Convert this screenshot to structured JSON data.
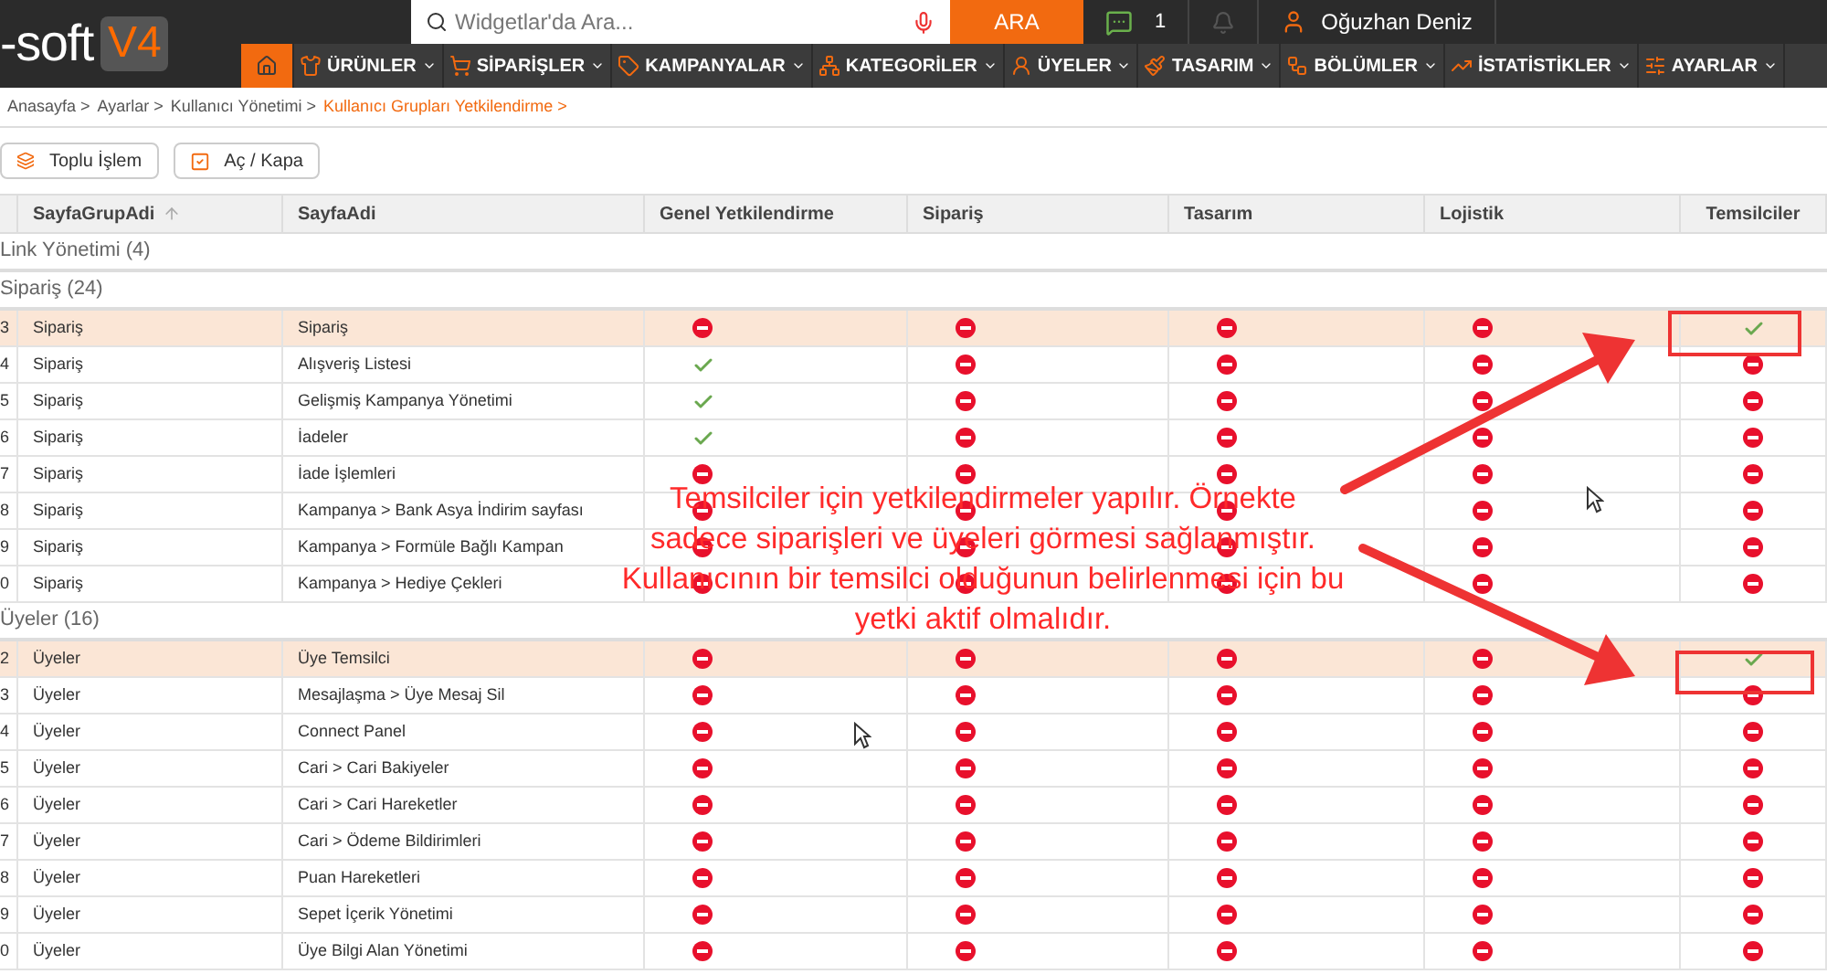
{
  "header": {
    "logo_text": "-soft",
    "logo_version": "V4",
    "search": {
      "placeholder": "Widgetlar'da Ara..."
    },
    "search_button": "ARA",
    "messages_count": "1",
    "user_name": "Oğuzhan Deniz"
  },
  "nav": [
    {
      "selected": true
    },
    {
      "label": "ÜRÜNLER",
      "selected": false
    },
    {
      "label": "SİPARİŞLER",
      "selected": false
    },
    {
      "label": "KAMPANYALAR",
      "selected": false
    },
    {
      "label": "KATEGORİLER",
      "selected": false
    },
    {
      "label": "ÜYELER",
      "selected": false
    },
    {
      "label": "TASARIM",
      "selected": false
    },
    {
      "label": "BÖLÜMLER",
      "selected": false
    },
    {
      "label": "İSTATİSTİKLER",
      "selected": false
    },
    {
      "label": "AYARLAR",
      "selected": false
    }
  ],
  "breadcrumb": [
    {
      "label": "Anasayfa >",
      "current": false
    },
    {
      "label": "Ayarlar >",
      "current": false
    },
    {
      "label": "Kullanıcı Yönetimi >",
      "current": false
    },
    {
      "label": "Kullanıcı Grupları Yetkilendirme >",
      "current": true
    }
  ],
  "toolbar": [
    "Toplu İşlem",
    "Aç / Kapa"
  ],
  "table": {
    "columns": [
      "SayfaGrupAdi",
      "SayfaAdi",
      "Genel Yetkilendirme",
      "Sipariş",
      "Tasarım",
      "Lojistik",
      "Temsilciler"
    ],
    "groups": [
      {
        "title": "Link Yönetimi (4)"
      },
      {
        "title": "Sipariş (24)",
        "rows": [
          {
            "number": "3",
            "group": "Sipariş",
            "page": "Sipariş",
            "selected": true,
            "perms": [
              false,
              false,
              false,
              false,
              true
            ]
          },
          {
            "number": "4",
            "group": "Sipariş",
            "page": "Alışveriş Listesi",
            "selected": false,
            "perms": [
              true,
              false,
              false,
              false,
              false
            ]
          },
          {
            "number": "5",
            "group": "Sipariş",
            "page": "Gelişmiş Kampanya Yönetimi",
            "selected": false,
            "perms": [
              true,
              false,
              false,
              false,
              false
            ]
          },
          {
            "number": "6",
            "group": "Sipariş",
            "page": "İadeler",
            "selected": false,
            "perms": [
              true,
              false,
              false,
              false,
              false
            ]
          },
          {
            "number": "7",
            "group": "Sipariş",
            "page": "İade İşlemleri",
            "selected": false,
            "perms": [
              false,
              false,
              false,
              false,
              false
            ]
          },
          {
            "number": "8",
            "group": "Sipariş",
            "page": "Kampanya > Bank Asya İndirim sayfası",
            "selected": false,
            "perms": [
              false,
              false,
              false,
              false,
              false
            ]
          },
          {
            "number": "9",
            "group": "Sipariş",
            "page": "Kampanya > Formüle Bağlı Kampan",
            "selected": false,
            "perms": [
              false,
              false,
              false,
              false,
              false
            ]
          },
          {
            "number": "0",
            "group": "Sipariş",
            "page": "Kampanya > Hediye Çekleri",
            "selected": false,
            "perms": [
              false,
              false,
              false,
              false,
              false
            ]
          }
        ]
      },
      {
        "title": "Üyeler (16)",
        "rows": [
          {
            "number": "2",
            "group": "Üyeler",
            "page": "Üye Temsilci",
            "selected": true,
            "perms": [
              false,
              false,
              false,
              false,
              true
            ]
          },
          {
            "number": "3",
            "group": "Üyeler",
            "page": "Mesajlaşma > Üye Mesaj Sil",
            "selected": false,
            "perms": [
              false,
              false,
              false,
              false,
              false
            ]
          },
          {
            "number": "4",
            "group": "Üyeler",
            "page": "Connect Panel",
            "selected": false,
            "perms": [
              false,
              false,
              false,
              false,
              false
            ]
          },
          {
            "number": "5",
            "group": "Üyeler",
            "page": "Cari > Cari Bakiyeler",
            "selected": false,
            "perms": [
              false,
              false,
              false,
              false,
              false
            ]
          },
          {
            "number": "6",
            "group": "Üyeler",
            "page": "Cari > Cari Hareketler",
            "selected": false,
            "perms": [
              false,
              false,
              false,
              false,
              false
            ]
          },
          {
            "number": "7",
            "group": "Üyeler",
            "page": "Cari > Ödeme Bildirimleri",
            "selected": false,
            "perms": [
              false,
              false,
              false,
              false,
              false
            ]
          },
          {
            "number": "8",
            "group": "Üyeler",
            "page": "Puan Hareketleri",
            "selected": false,
            "perms": [
              false,
              false,
              false,
              false,
              false
            ]
          },
          {
            "number": "9",
            "group": "Üyeler",
            "page": "Sepet İçerik Yönetimi",
            "selected": false,
            "perms": [
              false,
              false,
              false,
              false,
              false
            ]
          },
          {
            "number": "0",
            "group": "Üyeler",
            "page": "Üye Bilgi Alan Yönetimi",
            "selected": false,
            "perms": [
              false,
              false,
              false,
              false,
              false
            ]
          }
        ]
      }
    ]
  },
  "annotation": "Temsilciler için yetkilendirmeler yapılır. Örnekte sadece siparişleri ve üyeleri görmesi sağlanmıştır. Kullanıcının bir temsilci olduğunun belirlenmesi için bu yetki aktif olmalıdır."
}
